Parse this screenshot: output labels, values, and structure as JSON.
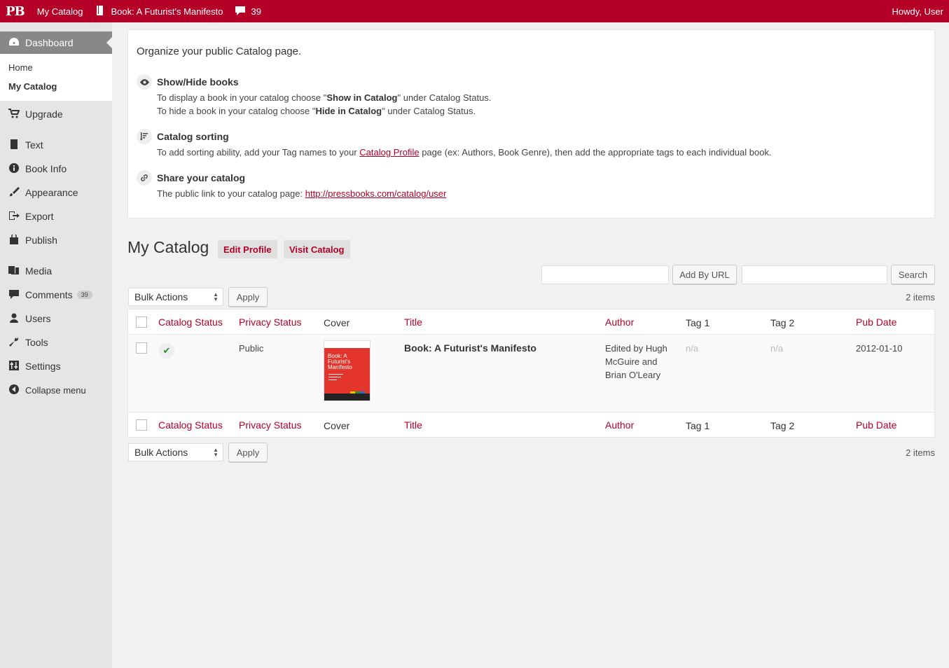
{
  "adminbar": {
    "logo": "PB",
    "site": "My Catalog",
    "book": "Book: A Futurist's Manifesto",
    "comments_count": "39",
    "greeting": "Howdy, User"
  },
  "sidebar": {
    "dashboard": "Dashboard",
    "sub": [
      "Home",
      "My Catalog"
    ],
    "items": [
      {
        "label": "Upgrade",
        "icon": "cart-icon"
      },
      {
        "label": "Text",
        "icon": "book-icon"
      },
      {
        "label": "Book Info",
        "icon": "info-icon"
      },
      {
        "label": "Appearance",
        "icon": "brush-icon"
      },
      {
        "label": "Export",
        "icon": "export-icon"
      },
      {
        "label": "Publish",
        "icon": "store-icon"
      },
      {
        "label": "Media",
        "icon": "media-icon"
      },
      {
        "label": "Comments",
        "icon": "comment-icon",
        "badge": "39"
      },
      {
        "label": "Users",
        "icon": "user-icon"
      },
      {
        "label": "Tools",
        "icon": "wrench-icon"
      },
      {
        "label": "Settings",
        "icon": "sliders-icon"
      }
    ],
    "collapse": "Collapse menu"
  },
  "help": {
    "intro": "Organize your public Catalog page.",
    "show_hide": {
      "title": "Show/Hide books",
      "l1_pre": "To display a book in your catalog choose \"",
      "l1_bold": "Show in Catalog",
      "l1_post": "\" under Catalog Status.",
      "l2_pre": "To hide a book in your catalog choose \"",
      "l2_bold": "Hide in Catalog",
      "l2_post": "\" under Catalog Status."
    },
    "sorting": {
      "title": "Catalog sorting",
      "pre": "To add sorting ability, add your Tag names to your ",
      "link": "Catalog Profile",
      "post": " page (ex: Authors, Book Genre), then add the appropriate tags to each individual book."
    },
    "share": {
      "title": "Share your catalog",
      "pre": "The public link to your catalog page: ",
      "link": "http://pressbooks.com/catalog/user"
    }
  },
  "catalog": {
    "title": "My Catalog",
    "edit_profile": "Edit Profile",
    "visit_catalog": "Visit Catalog",
    "add_by_url": "Add By URL",
    "search": "Search",
    "bulk_actions": "Bulk Actions",
    "apply": "Apply",
    "items_count": "2 items",
    "columns": {
      "catalog_status": "Catalog Status",
      "privacy_status": "Privacy Status",
      "cover": "Cover",
      "title": "Title",
      "author": "Author",
      "tag1": "Tag 1",
      "tag2": "Tag 2",
      "pub_date": "Pub Date"
    },
    "rows": [
      {
        "privacy": "Public",
        "cover_text": "Book: A Futurist's Manifesto",
        "title": "Book: A Futurist's Manifesto",
        "author_l1": "Edited by Hugh",
        "author_l2": "McGuire and",
        "author_l3": "Brian O'Leary",
        "tag1": "n/a",
        "tag2": "n/a",
        "pub_date": "2012-01-10"
      }
    ]
  },
  "colors": {
    "brand": "#b40026",
    "sidebar_active": "#888888",
    "sidebar_bg": "#e5e5e5"
  }
}
